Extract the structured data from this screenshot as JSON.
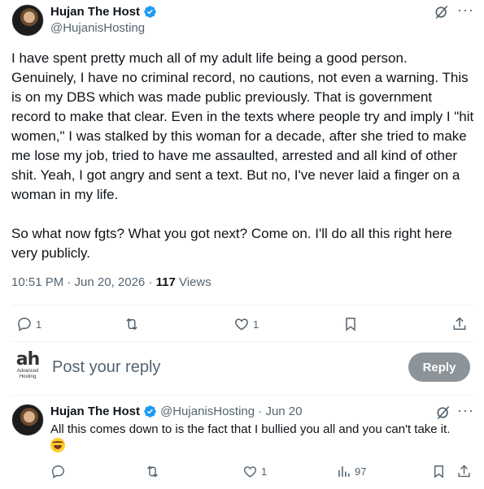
{
  "main_tweet": {
    "author": {
      "name": "Hujan The Host",
      "handle": "@HujanisHosting"
    },
    "paragraphs": [
      "I have spent pretty much all of my adult life being a good person. Genuinely, I have no criminal record, no cautions, not even a warning. This is on my DBS which was made public previously. That is government record to make that clear. Even in the texts where people try and imply I \"hit women,\" I was stalked by this woman for a decade, after she tried to make me lose my job, tried to have me assaulted, arrested and all kind of other shit. Yeah, I got angry and sent a text. But no, I've never laid a finger on a woman in my life.",
      "So what now fgts? What you got next? Come on. I'll do all this right here very publicly."
    ],
    "timestamp": "10:51 PM · Jun 20, 2026 · ",
    "views_count": "117",
    "views_label": " Views",
    "actions": {
      "reply_count": "1",
      "like_count": "1"
    }
  },
  "composer": {
    "avatar_mark": "ah",
    "avatar_sub1": "Advanced",
    "avatar_sub2": "Hosting",
    "placeholder": "Post your reply",
    "reply_label": "Reply"
  },
  "reply_tweet": {
    "author": {
      "name": "Hujan The Host",
      "handle": "@HujanisHosting · Jun 20"
    },
    "text": "All this comes down to is the fact that I bullied you all and you can't take it.",
    "actions": {
      "like_count": "1",
      "views_count": "97"
    }
  },
  "icons": {
    "verified": "verified-badge-icon",
    "grok": "grok-icon",
    "more": "more-icon",
    "reply": "reply-icon",
    "repost": "repost-icon",
    "like": "like-icon",
    "bookmark": "bookmark-icon",
    "share": "share-icon",
    "analytics": "analytics-icon",
    "emoji": "face-with-tears-of-joy-emoji"
  },
  "colors": {
    "verified": "#1d9bf0",
    "muted": "#536471",
    "reply_button": "#8c9399"
  }
}
